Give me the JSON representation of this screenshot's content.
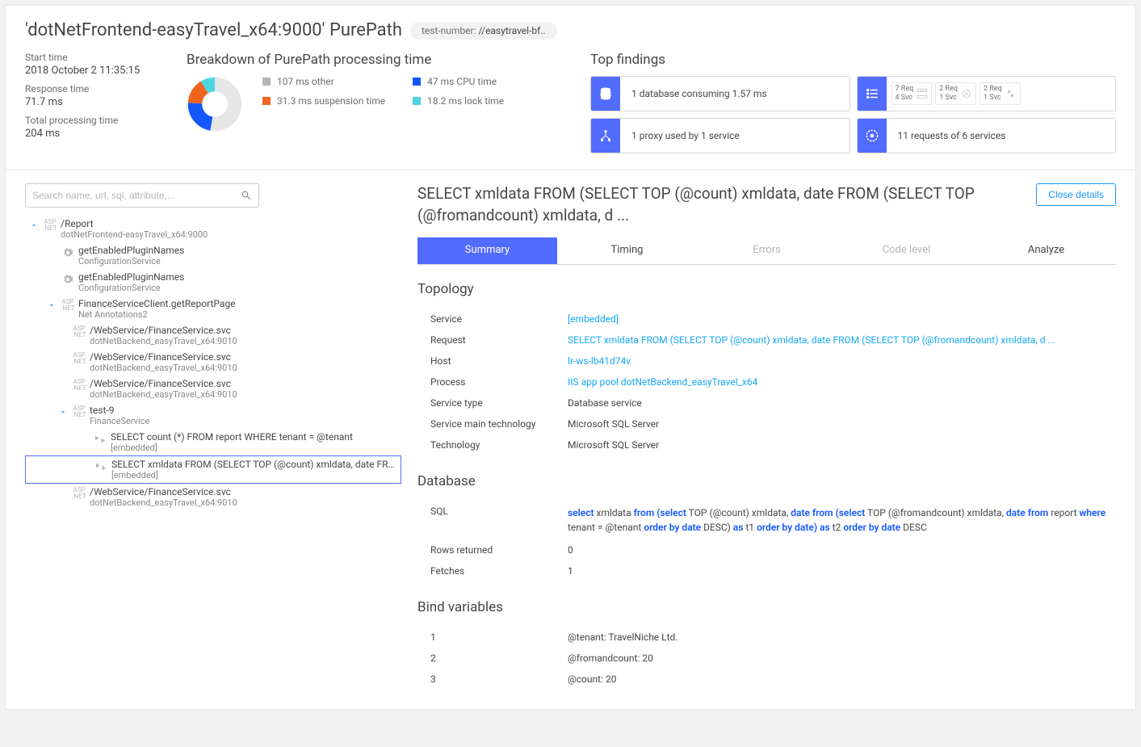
{
  "title": "'dotNetFrontend-easyTravel_x64:9000' PurePath",
  "tag": {
    "label": "test-number:",
    "value": "//easytravel-bf.."
  },
  "meta": {
    "start_label": "Start time",
    "start": "2018 October 2 11:35:15",
    "resp_label": "Response time",
    "resp": "71.7 ms",
    "total_label": "Total processing time",
    "total": "204 ms"
  },
  "breakdown": {
    "heading": "Breakdown of PurePath processing time",
    "items": [
      {
        "label": "107 ms other",
        "color": "#b5b5b5"
      },
      {
        "label": "47 ms CPU time",
        "color": "#1557ff"
      },
      {
        "label": "31.3 ms suspension time",
        "color": "#ef651f"
      },
      {
        "label": "18.2 ms lock time",
        "color": "#4fd5e0"
      }
    ]
  },
  "findings": {
    "heading": "Top findings",
    "db": "1 database consuming 1.57 ms",
    "proxy": "1 proxy used by 1 service",
    "requests": "11 requests of 6 services",
    "mini": [
      {
        "top": "7 Req",
        "bot": "4 Svc"
      },
      {
        "top": "2 Req",
        "bot": "1 Svc"
      },
      {
        "top": "2 Req",
        "bot": "1 Svc"
      }
    ]
  },
  "search_placeholder": "Search name, url, sql, attribute,...",
  "tree": [
    {
      "lvl": "1",
      "chev": true,
      "icon": "asp",
      "title": "/Report",
      "sub": "dotNetFrontend-easyTravel_x64:9000"
    },
    {
      "lvl": "2",
      "icon": "gear",
      "title": "getEnabledPluginNames",
      "sub": "ConfigurationService"
    },
    {
      "lvl": "2",
      "icon": "gear",
      "title": "getEnabledPluginNames",
      "sub": "ConfigurationService"
    },
    {
      "lvl": "2",
      "chev": true,
      "icon": "asp",
      "title": "FinanceServiceClient.getReportPage",
      "sub": "Net Annotations2"
    },
    {
      "lvl": "3",
      "icon": "asp",
      "title": "/WebService/FinanceService.svc",
      "sub": "dotNetBackend_easyTravel_x64:9010"
    },
    {
      "lvl": "3",
      "icon": "asp",
      "title": "/WebService/FinanceService.svc",
      "sub": "dotNetBackend_easyTravel_x64:9010"
    },
    {
      "lvl": "3",
      "icon": "asp",
      "title": "/WebService/FinanceService.svc",
      "sub": "dotNetBackend_easyTravel_x64:9010"
    },
    {
      "lvl": "3",
      "chev": true,
      "icon": "asp",
      "title": "test-9",
      "sub": "FinanceService"
    },
    {
      "lvl": "4",
      "icon": "db",
      "title": "SELECT count (*) FROM report WHERE tenant = @tenant",
      "sub": "[embedded]"
    },
    {
      "lvl": "4",
      "icon": "db",
      "title": "SELECT xmldata FROM (SELECT TOP (@count) xmldata, date FROM (SELE...",
      "sub": "[embedded]",
      "selected": true
    },
    {
      "lvl": "3",
      "icon": "asp",
      "title": "/WebService/FinanceService.svc",
      "sub": "dotNetBackend_easyTravel_x64:9010"
    }
  ],
  "detail": {
    "title": "SELECT xmldata FROM (SELECT TOP (@count) xmldata, date FROM (SELECT TOP (@fromandcount) xmldata, d ...",
    "close": "Close details",
    "tabs": [
      "Summary",
      "Timing",
      "Errors",
      "Code level",
      "Analyze"
    ],
    "topology_h": "Topology",
    "topo": [
      {
        "k": "Service",
        "v": "[embedded]",
        "link": true
      },
      {
        "k": "Request",
        "v": "SELECT xmldata FROM (SELECT TOP (@count) xmldata, date FROM (SELECT TOP (@fromandcount) xmldata, d ...",
        "link": true
      },
      {
        "k": "Host",
        "v": "lr-ws-lb41d74v",
        "link": true
      },
      {
        "k": "Process",
        "v": "IIS app pool dotNetBackend_easyTravel_x64",
        "link": true
      },
      {
        "k": "Service type",
        "v": "Database service"
      },
      {
        "k": "Service main technology",
        "v": "Microsoft SQL Server"
      },
      {
        "k": "Technology",
        "v": "Microsoft SQL Server"
      }
    ],
    "database_h": "Database",
    "rows_k": "Rows returned",
    "rows_v": "0",
    "fetch_k": "Fetches",
    "fetch_v": "1",
    "sql_k": "SQL",
    "bind_h": "Bind variables",
    "binds": [
      {
        "k": "1",
        "v": "@tenant: TravelNiche Ltd."
      },
      {
        "k": "2",
        "v": "@fromandcount: 20"
      },
      {
        "k": "3",
        "v": "@count: 20"
      }
    ]
  },
  "chart_data": {
    "type": "pie",
    "title": "Breakdown of PurePath processing time",
    "series": [
      {
        "name": "other",
        "value": 107,
        "color": "#b5b5b5",
        "unit": "ms"
      },
      {
        "name": "CPU time",
        "value": 47,
        "color": "#1557ff",
        "unit": "ms"
      },
      {
        "name": "suspension time",
        "value": 31.3,
        "color": "#ef651f",
        "unit": "ms"
      },
      {
        "name": "lock time",
        "value": 18.2,
        "color": "#4fd5e0",
        "unit": "ms"
      }
    ],
    "total": 203.5
  }
}
